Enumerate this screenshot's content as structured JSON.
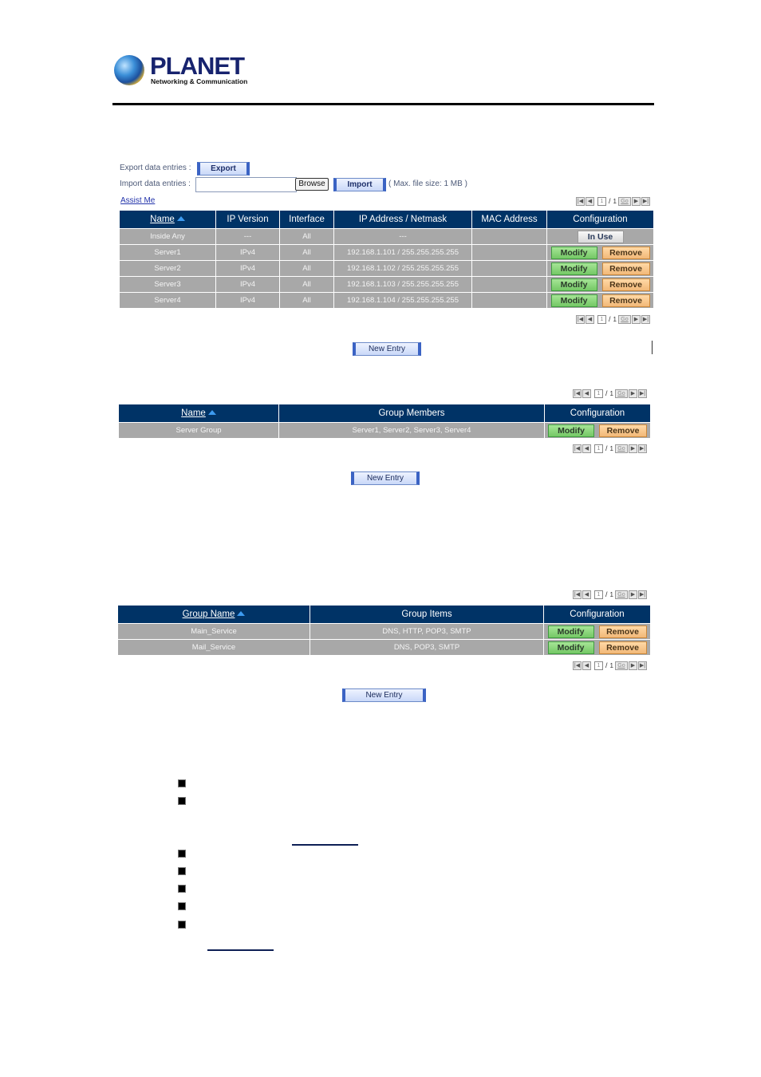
{
  "header": {
    "brand": "PLANET",
    "tagline": "Networking & Communication"
  },
  "import_export": {
    "export_label": "Export data entries :",
    "export_button": "Export",
    "import_label": "Import data entries :",
    "file_value": "",
    "browse_button": "Browse",
    "import_button": "Import",
    "max_size_note": "( Max. file size: 1 MB )",
    "assist_link": "Assist Me"
  },
  "pager": {
    "first_icon": "first-page-icon",
    "prev_icon": "prev-page-icon",
    "current_page": "1",
    "separator": "/",
    "total_pages": "1",
    "go_label": "Go",
    "next_icon": "next-page-icon",
    "last_icon": "last-page-icon"
  },
  "address_table": {
    "headers": [
      "Name",
      "IP Version",
      "Interface",
      "IP Address / Netmask",
      "MAC Address",
      "Configuration"
    ],
    "rows": [
      {
        "name": "Inside Any",
        "ip_version": "---",
        "interface": "All",
        "ip_netmask": "---",
        "mac": "",
        "config": "in-use"
      },
      {
        "name": "Server1",
        "ip_version": "IPv4",
        "interface": "All",
        "ip_netmask": "192.168.1.101 / 255.255.255.255",
        "mac": "",
        "config": "edit"
      },
      {
        "name": "Server2",
        "ip_version": "IPv4",
        "interface": "All",
        "ip_netmask": "192.168.1.102 / 255.255.255.255",
        "mac": "",
        "config": "edit"
      },
      {
        "name": "Server3",
        "ip_version": "IPv4",
        "interface": "All",
        "ip_netmask": "192.168.1.103 / 255.255.255.255",
        "mac": "",
        "config": "edit"
      },
      {
        "name": "Server4",
        "ip_version": "IPv4",
        "interface": "All",
        "ip_netmask": "192.168.1.104 / 255.255.255.255",
        "mac": "",
        "config": "edit"
      }
    ],
    "new_entry": "New Entry"
  },
  "buttons": {
    "modify": "Modify",
    "remove": "Remove",
    "in_use": "In Use"
  },
  "group_table": {
    "headers": [
      "Name",
      "Group Members",
      "Configuration"
    ],
    "rows": [
      {
        "name": "Server Group",
        "members": "Server1, Server2, Server3, Server4"
      }
    ],
    "new_entry": "New Entry"
  },
  "service_group_table": {
    "headers": [
      "Group Name",
      "Group Items",
      "Configuration"
    ],
    "rows": [
      {
        "name": "Main_Service",
        "items": "DNS, HTTP, POP3, SMTP"
      },
      {
        "name": "Mail_Service",
        "items": "DNS, POP3, SMTP"
      }
    ],
    "new_entry": "New Entry"
  },
  "bullets": {
    "count": 7,
    "icon": "square-bullet-icon"
  }
}
